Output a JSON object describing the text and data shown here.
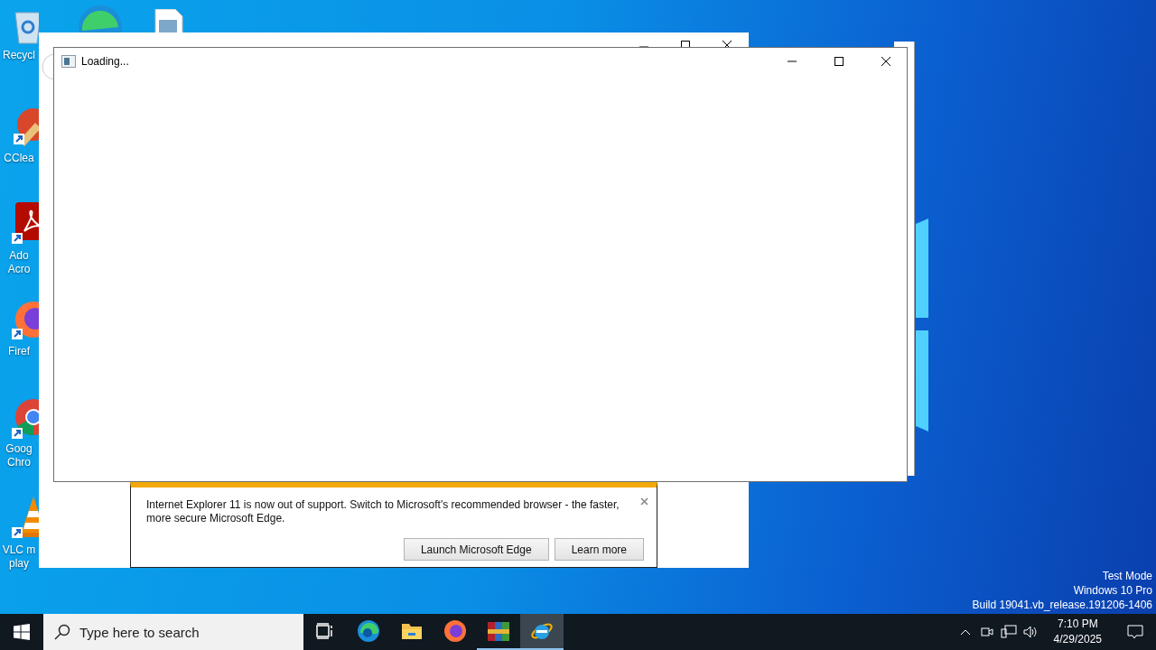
{
  "desktop_icons": [
    {
      "kind": "recycle",
      "lines": [
        "Recycl"
      ]
    },
    {
      "kind": "ccleaner",
      "lines": [
        "CClea"
      ]
    },
    {
      "kind": "acrobat",
      "lines": [
        "Ado",
        "Acro"
      ]
    },
    {
      "kind": "firefox",
      "lines": [
        "Firef"
      ]
    },
    {
      "kind": "chrome",
      "lines": [
        "Goog",
        "Chro"
      ]
    },
    {
      "kind": "vlc",
      "lines": [
        "VLC m",
        "play"
      ]
    }
  ],
  "dialog": {
    "title": "Loading..."
  },
  "notification": {
    "message": "Internet Explorer 11 is now out of support. Switch to Microsoft's recommended browser - the faster, more secure Microsoft Edge.",
    "buttons": [
      "Launch Microsoft Edge",
      "Learn more"
    ]
  },
  "system_info": [
    "Test Mode",
    "Windows 10 Pro",
    "Build 19041.vb_release.191206-1406"
  ],
  "taskbar": {
    "search": {
      "placeholder": "Type here to search"
    },
    "apps": [
      {
        "kind": "taskview",
        "running": false,
        "selected": false
      },
      {
        "kind": "edge",
        "running": false,
        "selected": false
      },
      {
        "kind": "explorer",
        "running": false,
        "selected": false
      },
      {
        "kind": "firefox",
        "running": false,
        "selected": false
      },
      {
        "kind": "winrar",
        "running": true,
        "selected": false
      },
      {
        "kind": "ie",
        "running": true,
        "selected": true
      }
    ],
    "time": "7:10 PM",
    "date": "4/29/2025"
  }
}
